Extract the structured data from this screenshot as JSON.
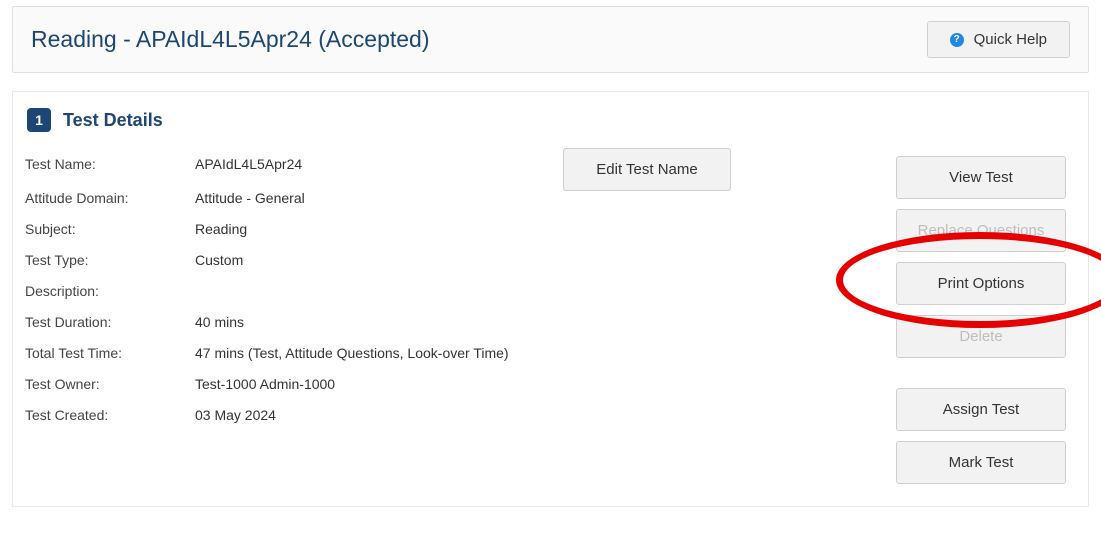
{
  "header": {
    "title": "Reading - APAIdL4L5Apr24 (Accepted)",
    "quick_help": "Quick Help"
  },
  "section": {
    "step_number": "1",
    "title": "Test Details"
  },
  "details": {
    "labels": {
      "test_name": "Test Name:",
      "attitude_domain": "Attitude Domain:",
      "subject": "Subject:",
      "test_type": "Test Type:",
      "description": "Description:",
      "test_duration": "Test Duration:",
      "total_test_time": "Total Test Time:",
      "test_owner": "Test Owner:",
      "test_created": "Test Created:"
    },
    "values": {
      "test_name": "APAIdL4L5Apr24",
      "attitude_domain": "Attitude - General",
      "subject": "Reading",
      "test_type": "Custom",
      "description": "",
      "test_duration": "40 mins",
      "total_test_time": "47 mins (Test, Attitude Questions, Look-over Time)",
      "test_owner": "Test-1000 Admin-1000",
      "test_created": "03 May 2024"
    }
  },
  "buttons": {
    "edit_test_name": "Edit Test Name",
    "view_test": "View Test",
    "replace_questions": "Replace Questions",
    "print_options": "Print Options",
    "delete": "Delete",
    "assign_test": "Assign Test",
    "mark_test": "Mark Test"
  },
  "highlight": {
    "target_button": "print-options-button"
  }
}
